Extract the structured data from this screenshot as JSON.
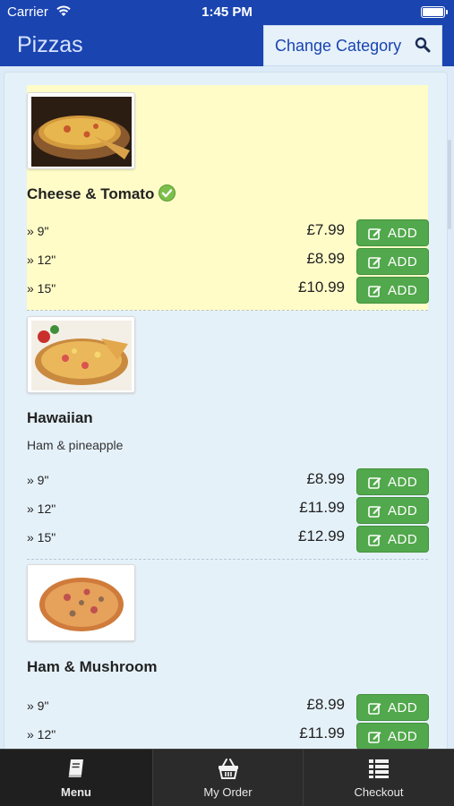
{
  "status": {
    "carrier": "Carrier",
    "time": "1:45 PM"
  },
  "header": {
    "title": "Pizzas",
    "category_button": "Change Category"
  },
  "items": [
    {
      "name": "Cheese & Tomato",
      "description": "",
      "selected": true,
      "options": [
        {
          "size": "» 9\"",
          "price": "£7.99",
          "button": "ADD"
        },
        {
          "size": "» 12\"",
          "price": "£8.99",
          "button": "ADD"
        },
        {
          "size": "» 15\"",
          "price": "£10.99",
          "button": "ADD"
        }
      ]
    },
    {
      "name": "Hawaiian",
      "description": "Ham & pineapple",
      "selected": false,
      "options": [
        {
          "size": "» 9\"",
          "price": "£8.99",
          "button": "ADD"
        },
        {
          "size": "» 12\"",
          "price": "£11.99",
          "button": "ADD"
        },
        {
          "size": "» 15\"",
          "price": "£12.99",
          "button": "ADD"
        }
      ]
    },
    {
      "name": "Ham & Mushroom",
      "description": "",
      "selected": false,
      "options": [
        {
          "size": "» 9\"",
          "price": "£8.99",
          "button": "ADD"
        },
        {
          "size": "» 12\"",
          "price": "£11.99",
          "button": "ADD"
        }
      ]
    }
  ],
  "tabs": [
    {
      "label": "Menu",
      "icon": "book-icon",
      "active": true
    },
    {
      "label": "My Order",
      "icon": "basket-icon",
      "active": false
    },
    {
      "label": "Checkout",
      "icon": "list-icon",
      "active": false
    }
  ],
  "colors": {
    "header": "#1a44b0",
    "add_button": "#52a84c",
    "highlight": "#fffcc8",
    "tab_bar": "#2b2b2b"
  }
}
